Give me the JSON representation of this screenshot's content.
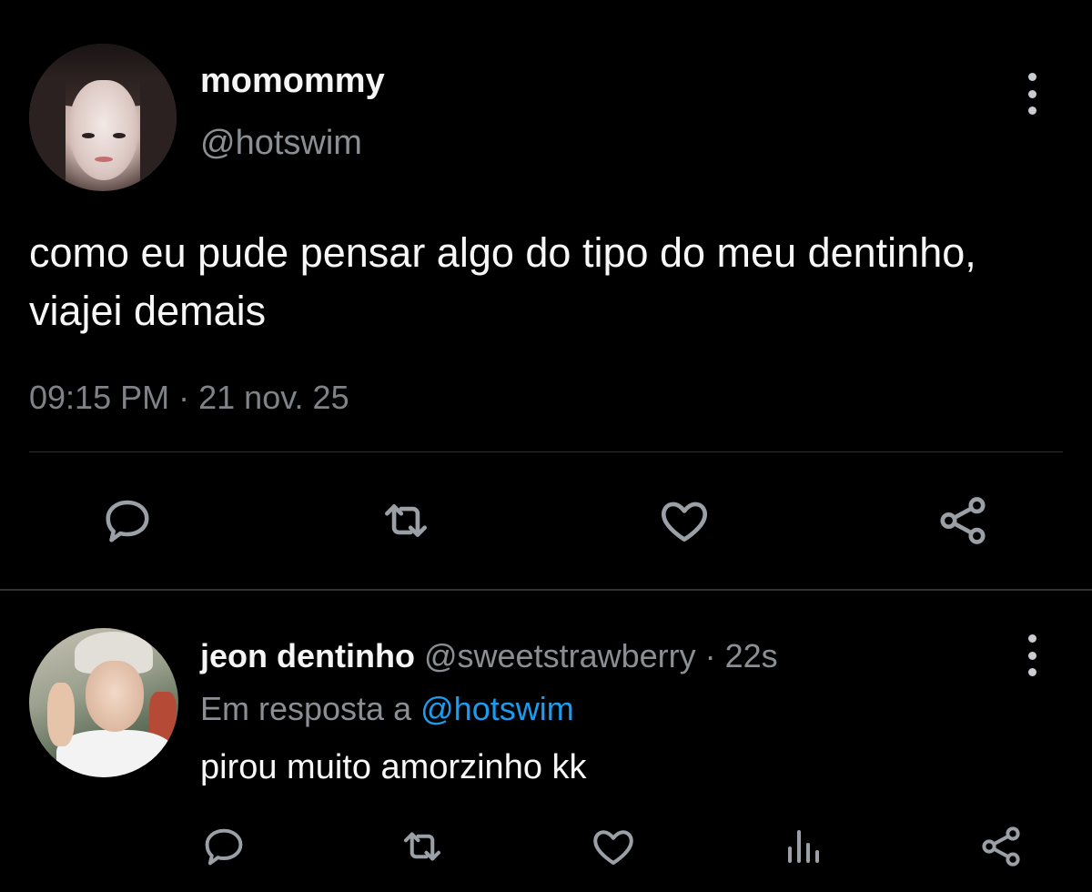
{
  "main_tweet": {
    "display_name": "momommy",
    "handle": "@hotswim",
    "text": "como eu pude pensar algo do tipo do meu dentinho, viajei demais",
    "time": "09:15 PM",
    "separator": "·",
    "date": "21 nov. 25",
    "actions": [
      "reply-icon",
      "retweet-icon",
      "like-icon",
      "share-icon"
    ]
  },
  "reply_tweet": {
    "display_name": "jeon dentinho",
    "handle": "@sweetstrawberry",
    "separator": "·",
    "time": "22s",
    "reply_to_prefix": "Em resposta a",
    "reply_to_handle": "@hotswim",
    "text": "pirou muito amorzinho kk",
    "actions": [
      "reply-icon",
      "retweet-icon",
      "like-icon",
      "views-icon",
      "share-icon"
    ]
  },
  "colors": {
    "background": "#000000",
    "primary_text": "#f5f5f5",
    "secondary_text": "#8b8f94",
    "link": "#1d9bf0",
    "icon": "#9aa0a6",
    "divider": "#2f3336"
  }
}
